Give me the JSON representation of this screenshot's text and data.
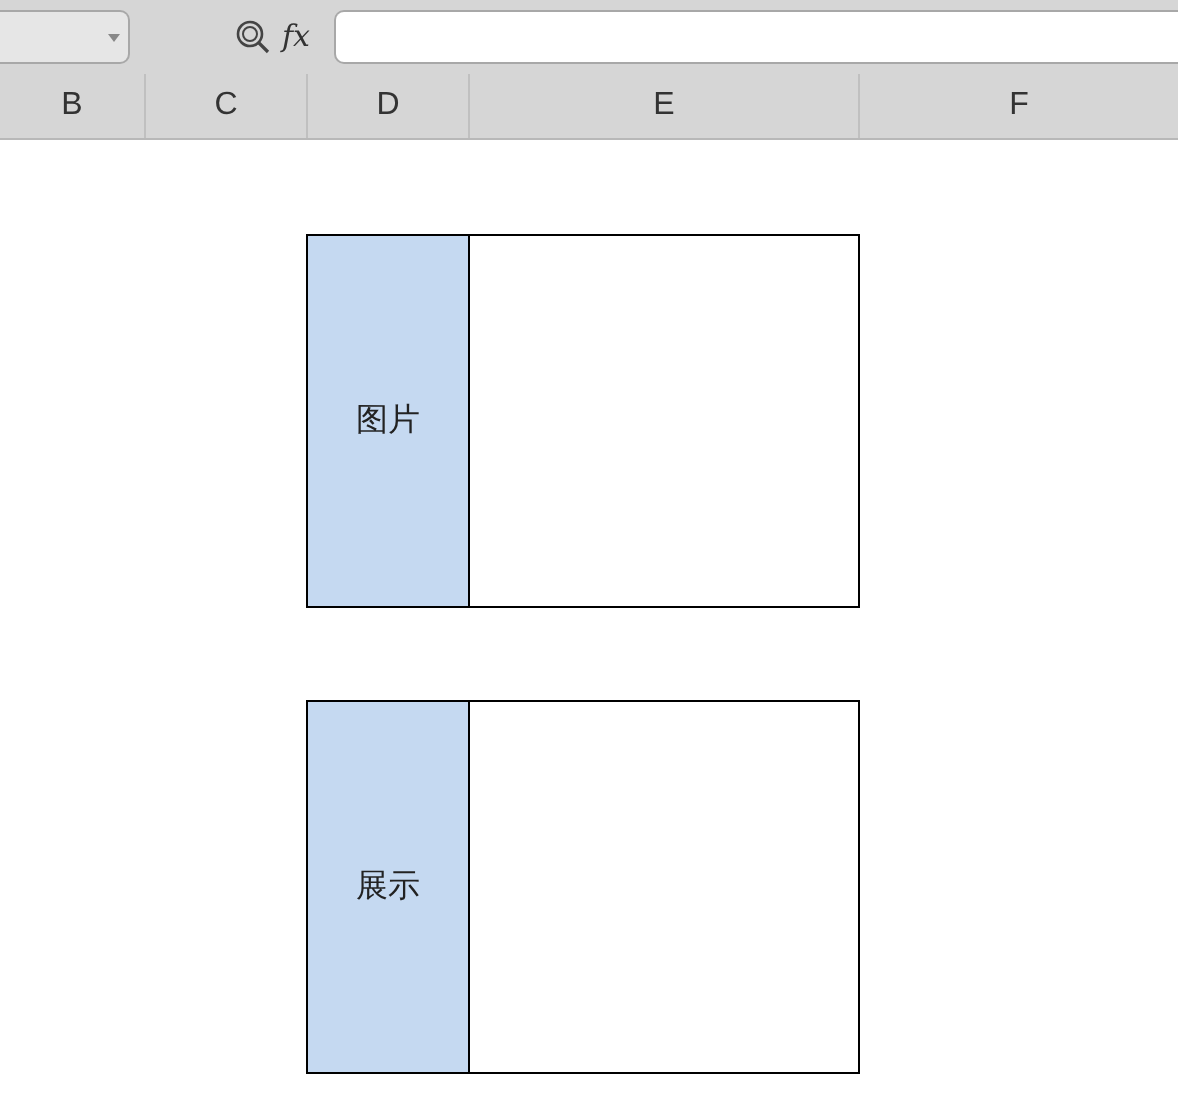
{
  "toolbar": {
    "formula_label": "fx"
  },
  "columns": [
    "B",
    "C",
    "D",
    "E",
    "F"
  ],
  "boxes": [
    {
      "label": "图片"
    },
    {
      "label": "展示"
    }
  ]
}
